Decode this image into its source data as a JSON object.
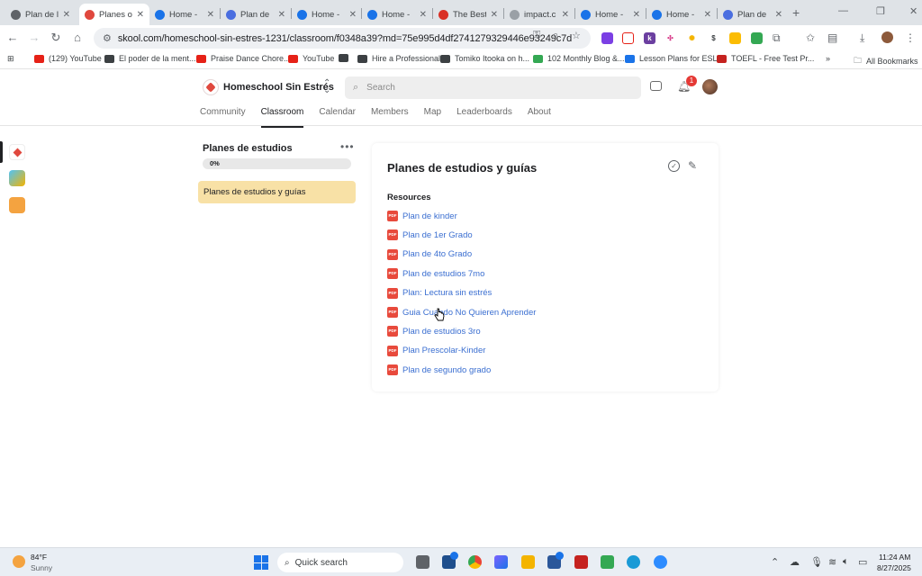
{
  "browser": {
    "tabs": [
      {
        "title": "Plan de l",
        "active": false,
        "favicon_color": "#5f6368"
      },
      {
        "title": "Planes o",
        "active": true,
        "favicon_color": "#e0483e"
      },
      {
        "title": "Home -",
        "active": false,
        "favicon_color": "#1a73e8"
      },
      {
        "title": "Plan de",
        "active": false,
        "favicon_color": "#4a6ee0"
      },
      {
        "title": "Home -",
        "active": false,
        "favicon_color": "#1a73e8"
      },
      {
        "title": "Home -",
        "active": false,
        "favicon_color": "#1a73e8"
      },
      {
        "title": "The Best",
        "active": false,
        "favicon_color": "#d93025"
      },
      {
        "title": "impact.c",
        "active": false,
        "favicon_color": "#9aa0a6"
      },
      {
        "title": "Home -",
        "active": false,
        "favicon_color": "#1a73e8"
      },
      {
        "title": "Home -",
        "active": false,
        "favicon_color": "#1a73e8"
      },
      {
        "title": "Plan de",
        "active": false,
        "favicon_color": "#4a6ee0"
      }
    ],
    "new_tab_label": "+",
    "url": "skool.com/homeschool-sin-estres-1231/classroom/f0348a39?md=75e995d4df2741279329446e93249c7d",
    "bookmarks": [
      {
        "label": "(129) YouTube",
        "color": "#e62117"
      },
      {
        "label": "El poder de la ment...",
        "color": "#3c4043"
      },
      {
        "label": "Praise Dance Chore...",
        "color": "#e62117"
      },
      {
        "label": "YouTube",
        "color": "#e62117"
      },
      {
        "label": "",
        "color": "#3c4043"
      },
      {
        "label": "Hire a Professional",
        "color": "#3c4043"
      },
      {
        "label": "Tomiko Itooka on h...",
        "color": "#3c4043"
      },
      {
        "label": "102 Monthly Blog &...",
        "color": "#34a853"
      },
      {
        "label": "Lesson Plans for ESL...",
        "color": "#1a73e8"
      },
      {
        "label": "TOEFL - Free Test Pr...",
        "color": "#c5221f"
      }
    ],
    "bookmarks_overflow": "»",
    "all_bookmarks": "All Bookmarks"
  },
  "header": {
    "group_name": "Homeschool Sin Estrés",
    "search_placeholder": "Search",
    "notification_count": "1",
    "nav": [
      {
        "label": "Community",
        "active": false
      },
      {
        "label": "Classroom",
        "active": true
      },
      {
        "label": "Calendar",
        "active": false
      },
      {
        "label": "Members",
        "active": false
      },
      {
        "label": "Map",
        "active": false
      },
      {
        "label": "Leaderboards",
        "active": false
      },
      {
        "label": "About",
        "active": false
      }
    ]
  },
  "sidebar": {
    "course_title": "Planes de estudios",
    "more_label": "•••",
    "progress_label": "0%",
    "progress_value": 0,
    "module_label": "Planes de estudios y guías"
  },
  "card": {
    "title": "Planes de estudios y guías",
    "resources_heading": "Resources",
    "pdf_label": "PDF",
    "resources": [
      "Plan de kinder",
      "Plan de 1er Grado",
      "Plan de 4to Grado",
      "Plan de estudios 7mo",
      "Plan: Lectura sin estrés",
      "Guia Cuando No Quieren Aprender",
      "Plan de estudios 3ro",
      "Plan Prescolar-Kinder",
      "Plan de segundo grado"
    ]
  },
  "taskbar": {
    "temperature": "84°F",
    "condition": "Sunny",
    "search_label": "Quick search",
    "time": "11:24 AM",
    "date": "8/27/2025"
  },
  "colors": {
    "accent_yellow": "#f8e1a6",
    "link_blue": "#3b6fd1",
    "pdf_red": "#e84a3c",
    "badge_red": "#e53935"
  }
}
